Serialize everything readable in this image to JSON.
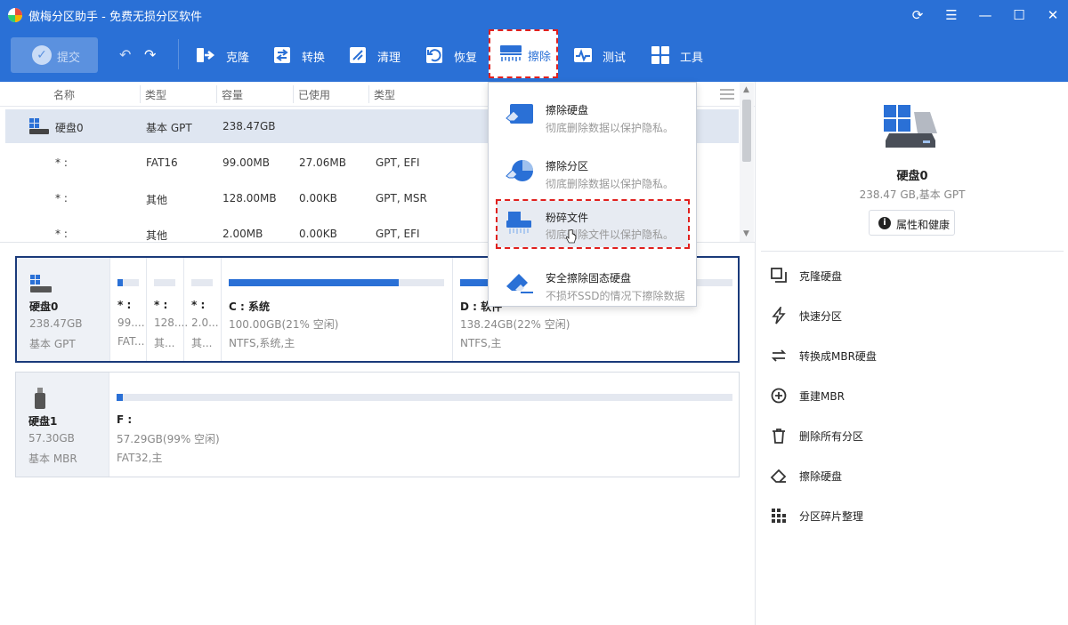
{
  "window": {
    "title": "傲梅分区助手 - 免费无损分区软件",
    "controls": [
      "refresh-icon",
      "menu-icon",
      "minimize-icon",
      "maximize-icon",
      "close-icon"
    ]
  },
  "toolbar": {
    "submit_label": "提交",
    "items": [
      {
        "label": "克隆",
        "icon": "clone-icon"
      },
      {
        "label": "转换",
        "icon": "convert-icon"
      },
      {
        "label": "清理",
        "icon": "clean-icon"
      },
      {
        "label": "恢复",
        "icon": "recover-icon"
      },
      {
        "label": "擦除",
        "icon": "wipe-icon",
        "active": true
      },
      {
        "label": "测试",
        "icon": "test-icon"
      },
      {
        "label": "工具",
        "icon": "tools-icon"
      }
    ]
  },
  "table": {
    "columns": [
      "名称",
      "类型",
      "容量",
      "已使用",
      "类型"
    ],
    "rows": [
      {
        "name": "硬盘0",
        "type": "基本 GPT",
        "capacity": "238.47GB",
        "used": "",
        "ptype": ""
      },
      {
        "name": "* :",
        "type": "FAT16",
        "capacity": "99.00MB",
        "used": "27.06MB",
        "ptype": "GPT, EFI"
      },
      {
        "name": "* :",
        "type": "其他",
        "capacity": "128.00MB",
        "used": "0.00KB",
        "ptype": "GPT, MSR"
      },
      {
        "name": "* :",
        "type": "其他",
        "capacity": "2.00MB",
        "used": "0.00KB",
        "ptype": "GPT, EFI"
      }
    ]
  },
  "disks": [
    {
      "name": "硬盘0",
      "size": "238.47GB",
      "style": "基本 GPT",
      "partitions": [
        {
          "name": "* :",
          "size": "99....",
          "fs": "FAT...",
          "fill": 0.25
        },
        {
          "name": "* :",
          "size": "128....",
          "fs": "其...",
          "fill": 0
        },
        {
          "name": "* :",
          "size": "2.0...",
          "fs": "其...",
          "fill": 0
        },
        {
          "name": "C : 系统",
          "size": "100.00GB(21% 空闲)",
          "fs": "NTFS,系统,主",
          "fill": 0.79
        },
        {
          "name": "D : 软件",
          "size": "138.24GB(22% 空闲)",
          "fs": "NTFS,主",
          "fill": 0.78
        }
      ]
    },
    {
      "name": "硬盘1",
      "size": "57.30GB",
      "style": "基本 MBR",
      "partitions": [
        {
          "name": "F :",
          "size": "57.29GB(99% 空闲)",
          "fs": "FAT32,主",
          "fill": 0.01
        }
      ]
    }
  ],
  "dropdown": {
    "items": [
      {
        "title": "擦除硬盘",
        "desc": "彻底删除数据以保护隐私。"
      },
      {
        "title": "擦除分区",
        "desc": "彻底删除数据以保护隐私。"
      },
      {
        "title": "粉碎文件",
        "desc": "彻底删除文件以保护隐私。"
      },
      {
        "title": "安全擦除固态硬盘",
        "desc": "不损坏SSD的情况下擦除数据"
      }
    ]
  },
  "right_panel": {
    "disk_title": "硬盘0",
    "disk_sub": "238.47 GB,基本 GPT",
    "properties_label": "属性和健康",
    "actions": [
      {
        "label": "克隆硬盘",
        "icon": "clone-disk-icon"
      },
      {
        "label": "快速分区",
        "icon": "quick-partition-icon"
      },
      {
        "label": "转换成MBR硬盘",
        "icon": "convert-mbr-icon"
      },
      {
        "label": "重建MBR",
        "icon": "rebuild-mbr-icon"
      },
      {
        "label": "删除所有分区",
        "icon": "trash-icon"
      },
      {
        "label": "擦除硬盘",
        "icon": "eraser-icon"
      },
      {
        "label": "分区碎片整理",
        "icon": "defrag-icon"
      }
    ]
  },
  "colors": {
    "brand": "#2a70d6",
    "highlight_border": "#e0201e",
    "selected_row": "#dfe6f1"
  }
}
